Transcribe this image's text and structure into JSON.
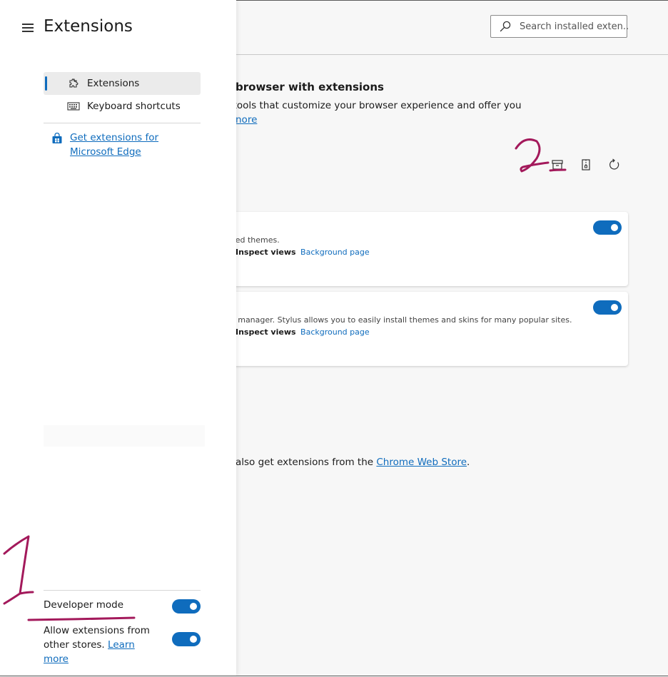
{
  "sidebar": {
    "title": "Extensions",
    "nav": [
      {
        "label": "Extensions",
        "icon": "puzzle-icon",
        "active": true
      },
      {
        "label": "Keyboard shortcuts",
        "icon": "keyboard-icon",
        "active": false
      }
    ],
    "get_extensions_link": "Get extensions for Microsoft Edge",
    "developer_mode": {
      "label": "Developer mode",
      "enabled": true
    },
    "allow_other_stores": {
      "label": "Allow extensions from other stores.",
      "link": "Learn more",
      "enabled": true
    }
  },
  "search": {
    "placeholder": "Search installed exten..."
  },
  "hero": {
    "title": "browser with extensions",
    "description": "e tools that customize your browser experience and offer you",
    "more_link": "nore"
  },
  "toolbar": {
    "icons": [
      "load-unpacked-icon",
      "pack-extension-icon",
      "update-icon"
    ]
  },
  "extensions": [
    {
      "description": "sed themes.",
      "inspect_label": "Inspect views",
      "inspect_link": "Background page",
      "enabled": true
    },
    {
      "description": "s manager. Stylus allows you to easily install themes and skins for many popular sites.",
      "inspect_label": "Inspect views",
      "inspect_link": "Background page",
      "enabled": true
    }
  ],
  "store_note": {
    "prefix": "also get extensions from the",
    "link": "Chrome Web Store",
    "suffix": "."
  },
  "annotations": {
    "mark_1": "1",
    "mark_2": "2",
    "color": "#a3195b"
  },
  "colors": {
    "accent": "#0f6cbd"
  }
}
